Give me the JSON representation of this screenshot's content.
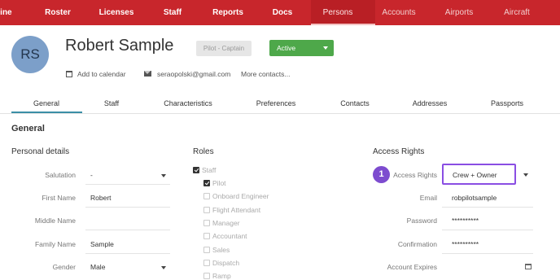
{
  "nav": {
    "items": [
      "line",
      "Roster",
      "Licenses",
      "Staff",
      "Reports",
      "Docs",
      "Persons",
      "Accounts",
      "Airports",
      "Aircraft"
    ],
    "active": "Persons"
  },
  "profile": {
    "initials": "RS",
    "name": "Robert Sample",
    "role_badge": "Pilot - Captain",
    "status": "Active",
    "add_to_calendar": "Add to calendar",
    "email": "seraopolski@gmail.com",
    "more_contacts": "More contacts..."
  },
  "tabs": [
    "General",
    "Staff",
    "Characteristics",
    "Preferences",
    "Contacts",
    "Addresses",
    "Passports"
  ],
  "active_tab": "General",
  "section_title": "General",
  "personal_details": {
    "heading": "Personal details",
    "fields": [
      {
        "label": "Salutation",
        "value": "-"
      },
      {
        "label": "First Name",
        "value": "Robert"
      },
      {
        "label": "Middle Name",
        "value": ""
      },
      {
        "label": "Family Name",
        "value": "Sample"
      },
      {
        "label": "Gender",
        "value": "Male"
      }
    ]
  },
  "roles": {
    "heading": "Roles",
    "items": [
      {
        "label": "Staff",
        "checked": true
      },
      {
        "label": "Pilot",
        "checked": true
      },
      {
        "label": "Onboard Engineer",
        "checked": false
      },
      {
        "label": "Flight Attendant",
        "checked": false
      },
      {
        "label": "Manager",
        "checked": false
      },
      {
        "label": "Accountant",
        "checked": false
      },
      {
        "label": "Sales",
        "checked": false
      },
      {
        "label": "Dispatch",
        "checked": false
      },
      {
        "label": "Ramp",
        "checked": false
      }
    ]
  },
  "access_rights": {
    "heading": "Access Rights",
    "step_number": "1",
    "fields": [
      {
        "label": "Access Rights",
        "value": "Crew + Owner"
      },
      {
        "label": "Email",
        "value": "robpilotsample"
      },
      {
        "label": "Password",
        "value": "**********"
      },
      {
        "label": "Confirmation",
        "value": "**********"
      },
      {
        "label": "Account Expires",
        "value": ""
      }
    ]
  },
  "colors": {
    "nav_bg": "#c8262c",
    "status_green": "#4ea84a",
    "highlight_purple": "#8a4ee3",
    "tab_accent": "#3b8fa6"
  }
}
